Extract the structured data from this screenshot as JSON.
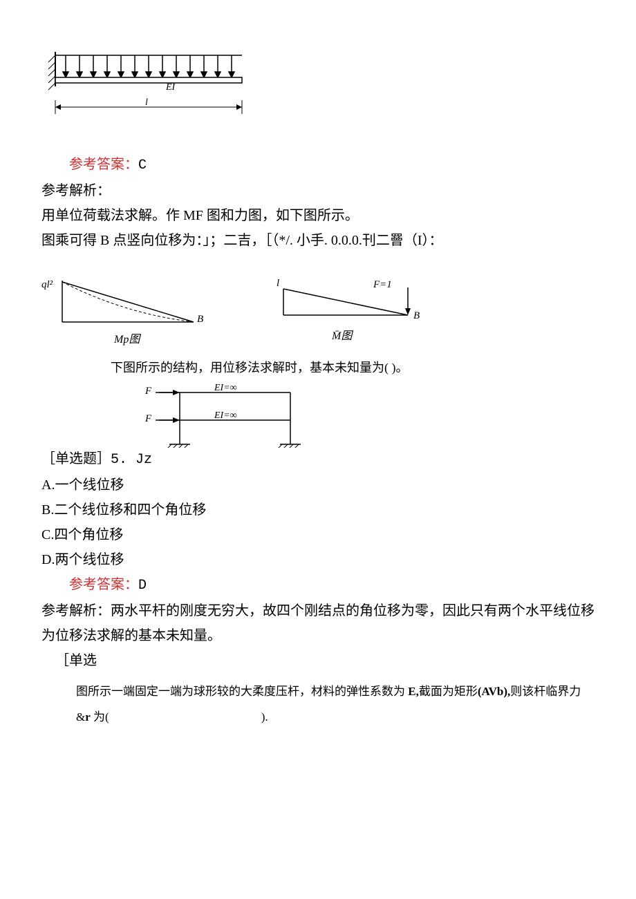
{
  "figure1": {
    "label_EI": "EI",
    "label_l": "l"
  },
  "q4": {
    "answer_label": "参考答案：",
    "answer_value": "C",
    "analysis_label": "参考解析：",
    "analysis_line1": "用单位荷载法求解。作 MF 图和力图，如下图所示。",
    "analysis_line2": "图乘可得 B 点竖向位移为：」；二吉，［（*/. 小手. 0.0.0.刊二罾（I）："
  },
  "figure2": {
    "left_top": "ql²",
    "left_right": "B",
    "left_caption": "Mp图",
    "right_top_l": "l",
    "right_top_f": "F=1",
    "right_right": "B",
    "right_caption": "M̄图"
  },
  "q5": {
    "stem": "下图所示的结构，用位移法求解时，基本未知量为(   )。",
    "fig_F": "F",
    "fig_EI": "EI=∞",
    "prefix": "［单选题］5. Jz",
    "optA": "A.一个线位移",
    "optB": "B.二个线位移和四个角位移",
    "optC": "C.四个角位移",
    "optD": "D.两个线位移",
    "answer_label": "参考答案：",
    "answer_value": "D",
    "analysis_label": "参考解析：",
    "analysis_text": "两水平杆的刚度无穷大，故四个刚结点的角位移为零，因此只有两个水平线位移为位移法求解的基本未知量。"
  },
  "q6": {
    "prefix": "［单选",
    "line1_a": "图所示一端固定一端为球形较的大柔度压杆，材料的弹性系数为 ",
    "line1_E": "E,",
    "line1_b": "截面为矩形",
    "line1_AVb": "(AVb),",
    "line1_c": "则该杆临界力",
    "line2_a": "&",
    "line2_r": "r",
    "line2_b": " 为(",
    "line2_c": ")."
  }
}
